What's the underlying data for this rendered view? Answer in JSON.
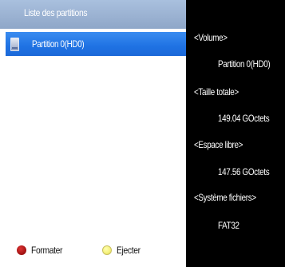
{
  "partition_list": {
    "title": "Liste des partitions",
    "items": [
      {
        "label": "Partition 0(HD0)",
        "selected": true,
        "icon": "hard-drive-icon"
      }
    ]
  },
  "details": {
    "volume_label": "<Volume>",
    "volume_value": "Partition 0(HD0)",
    "total_size_label": "<Taille totale>",
    "total_size_value": "149.04 GOctets",
    "free_space_label": "<Espace libre>",
    "free_space_value": "147.56 GOctets",
    "filesystem_label": "<Système fichiers>",
    "filesystem_value": "FAT32"
  },
  "legend": {
    "format_label": "Formater",
    "format_color": "red",
    "eject_label": "Ejecter",
    "eject_color": "yellow"
  },
  "colors": {
    "header": "#9bb2d2",
    "selection": "#1f72e3",
    "background": "#ffffff",
    "info_background": "#000000"
  }
}
